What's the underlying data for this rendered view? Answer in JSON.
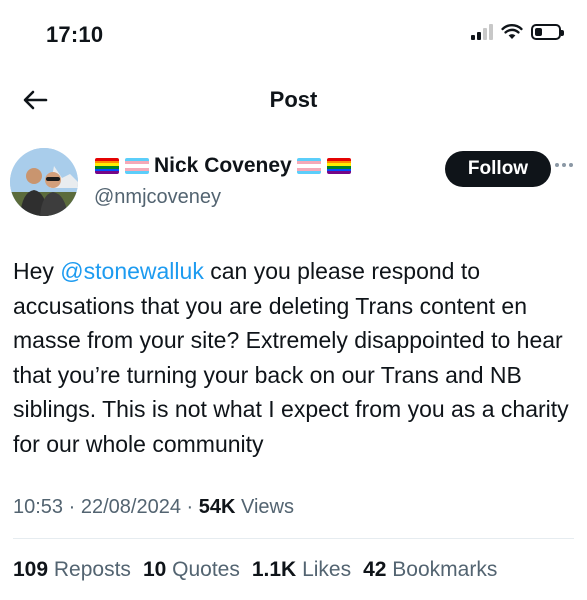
{
  "status_bar": {
    "time": "17:10",
    "battery_level": 0.3
  },
  "nav": {
    "back_icon": "arrow-left-icon",
    "title": "Post"
  },
  "author": {
    "name": "Nick Coveney",
    "handle": "@nmjcoveney",
    "follow_label": "Follow",
    "more_icon": "ellipsis-icon",
    "flags": [
      "rainbow-flag",
      "trans-flag"
    ]
  },
  "tweet": {
    "text_before_mention": "Hey ",
    "mention": "@stonewalluk",
    "text_after_mention": " can you please respond to accusations that you are deleting Trans content en masse from your site? Extremely disappointed to hear that you’re turning your back on our Trans and NB siblings. This is not what I expect from you as a charity for our whole community"
  },
  "meta": {
    "time": "10:53",
    "separator": " · ",
    "date": "22/08/2024",
    "views_count": "54K",
    "views_label": "Views"
  },
  "stats": [
    {
      "count": "109",
      "label": "Reposts"
    },
    {
      "count": "10",
      "label": "Quotes"
    },
    {
      "count": "1.1K",
      "label": "Likes"
    },
    {
      "count": "42",
      "label": "Bookmarks"
    }
  ],
  "colors": {
    "text": "#0f1419",
    "secondary": "#536471",
    "link": "#1d9bf0",
    "follow_bg": "#0f1419"
  }
}
